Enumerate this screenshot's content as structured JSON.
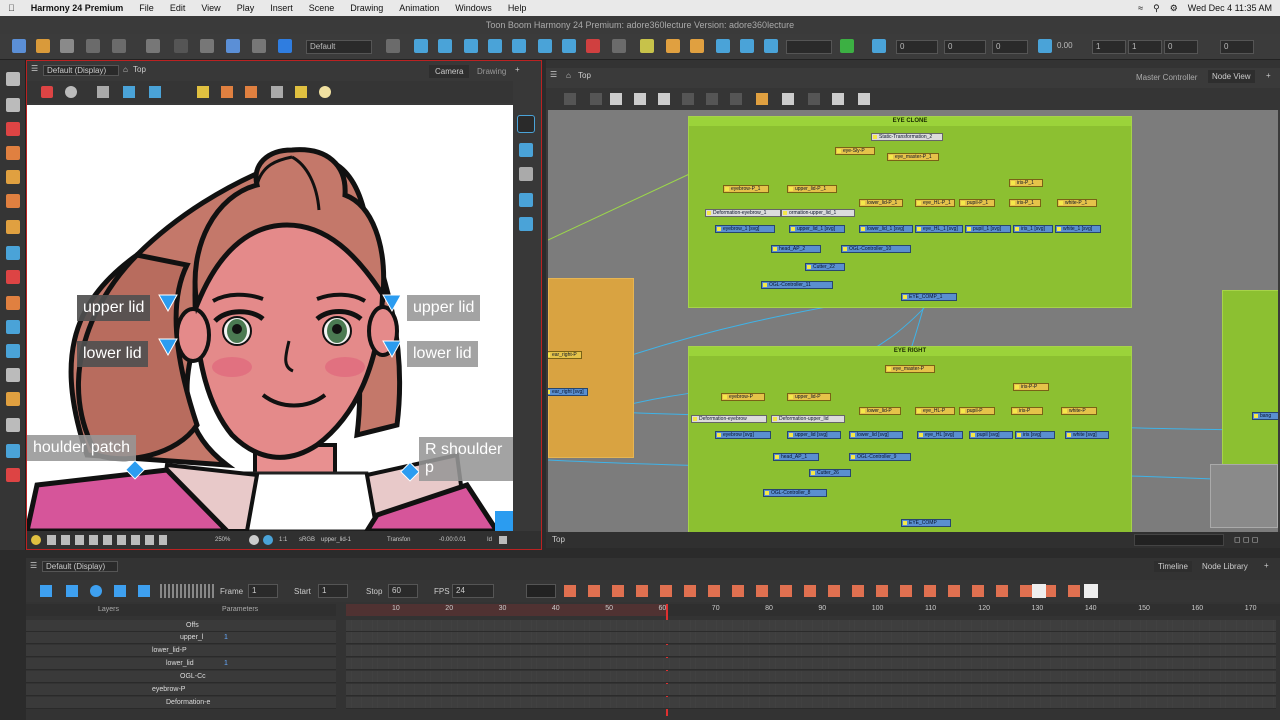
{
  "menubar": {
    "app": "Harmony 24 Premium",
    "items": [
      "File",
      "Edit",
      "View",
      "Play",
      "Insert",
      "Scene",
      "Drawing",
      "Animation",
      "Windows",
      "Help"
    ],
    "datetime": "Wed Dec 4  11:35 AM"
  },
  "window_title": "Toon Boom Harmony 24 Premium: adore360lecture Version: adore360lecture",
  "toolbar": {
    "preset": "Default",
    "f1": "0",
    "f2": "0",
    "f3": "0",
    "scale": "0.00",
    "f4": "1",
    "f5": "1",
    "f6": "0",
    "f7": "0"
  },
  "camera_view": {
    "view_mode": "Default (Display)",
    "breadcrumb": "Top",
    "tabs": [
      "Camera",
      "Drawing"
    ],
    "labels": {
      "upper_lid_left": "upper lid",
      "lower_lid_left": "lower lid",
      "upper_lid_right": "upper lid",
      "lower_lid_right": "lower lid",
      "shoulder_left": "houlder patch",
      "shoulder_right": "R shoulder p"
    },
    "status": {
      "zoom": "250%",
      "ratio": "1:1",
      "color_space": "sRGB",
      "layer": "upper_lid-1",
      "mode": "Transfon",
      "coords": "-0.00:0.01",
      "id_label": "Id"
    }
  },
  "node_view": {
    "breadcrumb": "Top",
    "tabs": [
      "Master Controller",
      "Node View"
    ],
    "footer": "Top",
    "groups": [
      {
        "title": "EYE CLONE"
      },
      {
        "title": "EYE RIGHT"
      }
    ],
    "nodes_clone": [
      "Static-Transformation_2",
      "eye-Sly-P",
      "eye_master-P_1",
      "eyebrow-P_1",
      "upper_lid-P_1",
      "lower_lid-P_1",
      "eye_HL-P_1",
      "pupil-P_1",
      "iris-P_1",
      "white-P_1",
      "iris-P_1",
      "Deformation-eyebrow_1",
      "ormation-upper_lid_1",
      "eyebrow_1 [svg]",
      "upper_lid_1 [svg]",
      "lower_lid_1 [svg]",
      "eye_HL_1 [svg]",
      "pupil_1 [svg]",
      "iris_1 [svg]",
      "white_1 [svg]",
      "head_AP_2",
      "OGL-Controller_10",
      "Cutter_22",
      "OGL-Controller_11",
      "EYE_COMP_1"
    ],
    "nodes_right": [
      "eye_master-P",
      "iris-P-P",
      "eyebrow-P",
      "upper_lid-P",
      "lower_lid-P",
      "eye_HL-P",
      "pupil-P",
      "iris-P",
      "white-P",
      "Deformation-eyebrow",
      "Deformation-upper_lid",
      "eyebrow [svg]",
      "upper_lid [svg]",
      "lower_lid [svg]",
      "eye_HL [svg]",
      "pupil [svg]",
      "iris [svg]",
      "white [svg]",
      "head_AP_1",
      "OGL-Controller_9",
      "Cutter_26",
      "OGL-Controller_8",
      "EYE_COMP"
    ],
    "nodes_other": [
      "ear_right-P",
      "ear_right [svg]",
      "bang"
    ]
  },
  "timeline": {
    "view_mode": "Default (Display)",
    "tabs": [
      "Timeline",
      "Node Library"
    ],
    "frame_label": "Frame",
    "frame": "1",
    "start_label": "Start",
    "start": "1",
    "stop_label": "Stop",
    "stop": "60",
    "fps_label": "FPS",
    "fps": "24",
    "layers_header": "Layers",
    "params_header": "Parameters",
    "ticks": [
      "10",
      "20",
      "30",
      "40",
      "50",
      "60",
      "70",
      "80",
      "90",
      "100",
      "110",
      "120",
      "130",
      "140",
      "150",
      "160",
      "170"
    ],
    "playhead_frame": 60,
    "layers": [
      {
        "name": "Offs",
        "value": ""
      },
      {
        "name": "upper_l",
        "value": "1"
      },
      {
        "name": "lower_lid-P",
        "value": ""
      },
      {
        "name": "lower_lid",
        "value": "1"
      },
      {
        "name": "OGL-Cc",
        "value": ""
      },
      {
        "name": "eyebrow-P",
        "value": ""
      },
      {
        "name": "Deformation-e",
        "value": ""
      }
    ]
  }
}
